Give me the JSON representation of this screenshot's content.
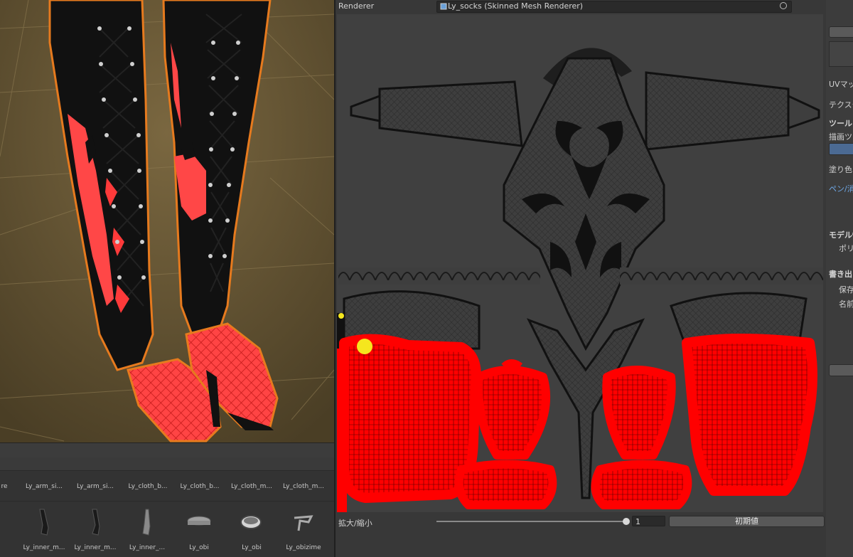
{
  "renderer": {
    "label": "Renderer",
    "value": "Ly_socks (Skinned Mesh Renderer)"
  },
  "zoom": {
    "label": "拡大/縮小",
    "value": "1",
    "reset_label": "初期値"
  },
  "project": {
    "row1": [
      "re",
      "Ly_arm_si...",
      "Ly_arm_si...",
      "Ly_cloth_b...",
      "Ly_cloth_b...",
      "Ly_cloth_m...",
      "Ly_cloth_m..."
    ],
    "row2": [
      "Ly_inner_m...",
      "Ly_inner_m...",
      "Ly_inner_...",
      "Ly_obi",
      "Ly_obi",
      "Ly_obizime"
    ]
  },
  "inspector": {
    "uv_map": "UVマッ",
    "texture": "テクスチ",
    "tool_header": "ツール",
    "draw_tool": "描画ツー",
    "paint_color": "塗り色",
    "pen_eraser": "ペン/消",
    "model_info": "モデル情",
    "polygon": "ポリゴ",
    "export_header": "書き出",
    "save": "保存",
    "name": "名前"
  },
  "colors": {
    "paint_red": "#ff0000",
    "cursor_yellow": "#f5e61e",
    "panel_bg": "#383838",
    "uv_bg": "#404040"
  }
}
